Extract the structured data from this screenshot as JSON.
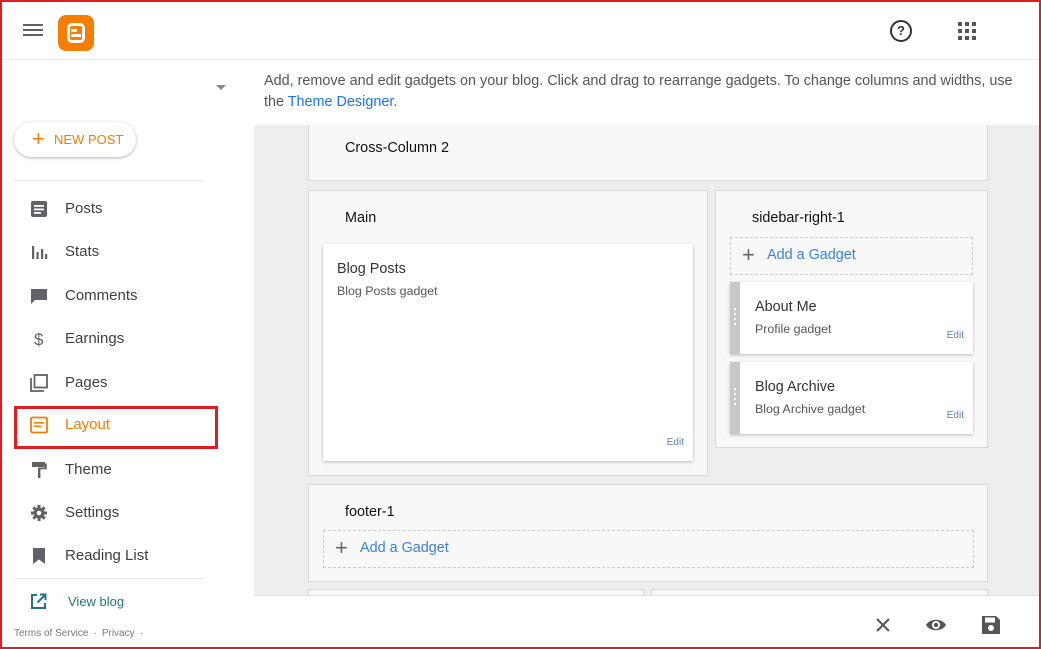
{
  "app": {
    "logo": "blogger-logo"
  },
  "header": {
    "menu_icon": "hamburger-menu-icon",
    "help_icon": "help-circle-icon",
    "apps_icon": "apps-grid-icon",
    "help_glyph": "?"
  },
  "sidebar": {
    "new_post_label": "NEW POST",
    "items": [
      {
        "label": "Posts",
        "icon": "posts-icon"
      },
      {
        "label": "Stats",
        "icon": "stats-icon"
      },
      {
        "label": "Comments",
        "icon": "comments-icon"
      },
      {
        "label": "Earnings",
        "icon": "dollar-icon"
      },
      {
        "label": "Pages",
        "icon": "pages-icon"
      },
      {
        "label": "Layout",
        "icon": "layout-icon",
        "active": true
      },
      {
        "label": "Theme",
        "icon": "paint-roller-icon"
      },
      {
        "label": "Settings",
        "icon": "gear-icon"
      },
      {
        "label": "Reading List",
        "icon": "bookmark-icon"
      }
    ],
    "view_blog_label": "View blog",
    "footer_links": [
      "Terms of Service",
      "Privacy"
    ]
  },
  "main": {
    "info_text": "Add, remove and edit gadgets on your blog. Click and drag to rearrange gadgets. To change columns and widths, use the ",
    "theme_designer_link": "Theme Designer",
    "info_end": ".",
    "sections": {
      "cross_column_2": "Cross-Column 2",
      "main": "Main",
      "sidebar_right_1": "sidebar-right-1",
      "footer_1": "footer-1"
    },
    "gadgets": {
      "blog_posts": {
        "title": "Blog Posts",
        "subtitle": "Blog Posts gadget",
        "edit": "Edit"
      },
      "about_me": {
        "title": "About Me",
        "subtitle": "Profile gadget",
        "edit": "Edit"
      },
      "blog_archive": {
        "title": "Blog Archive",
        "subtitle": "Blog Archive gadget",
        "edit": "Edit"
      }
    },
    "add_gadget_label": "Add a Gadget",
    "add_gadget_plus": "+"
  },
  "toolbar": {
    "close_icon": "close-icon",
    "preview_icon": "eye-icon",
    "save_icon": "save-icon"
  },
  "colors": {
    "accent": "#f57d00",
    "highlight_border": "#e21c23",
    "link": "#1a73e8",
    "view_blog": "#26737f"
  }
}
